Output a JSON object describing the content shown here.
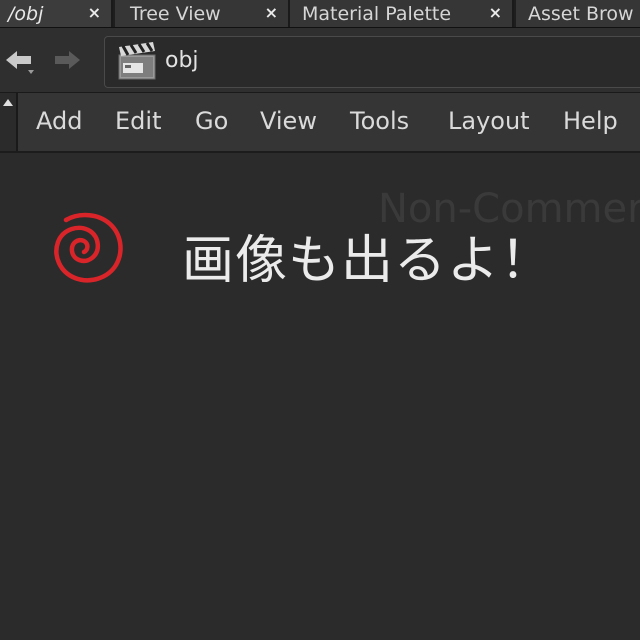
{
  "tabs": [
    {
      "label": "/obj",
      "close": "×",
      "active": true
    },
    {
      "label": "Tree View",
      "close": "×",
      "active": false
    },
    {
      "label": "Material Palette",
      "close": "×",
      "active": false
    },
    {
      "label": "Asset Brow",
      "close": "",
      "active": false
    }
  ],
  "pathbar": {
    "path": "obj",
    "icon": "clapperboard-icon",
    "back_icon": "arrow-left-icon",
    "forward_icon": "arrow-right-icon"
  },
  "menu": [
    "Add",
    "Edit",
    "Go",
    "View",
    "Tools",
    "Layout",
    "Help"
  ],
  "content": {
    "watermark": "Non-Commer",
    "caption": "画像も出るよ！",
    "logo_icon": "red-spiral-logo"
  },
  "colors": {
    "background": "#2b2b2b",
    "spiral": "#d9252a",
    "text": "#ebebeb"
  }
}
